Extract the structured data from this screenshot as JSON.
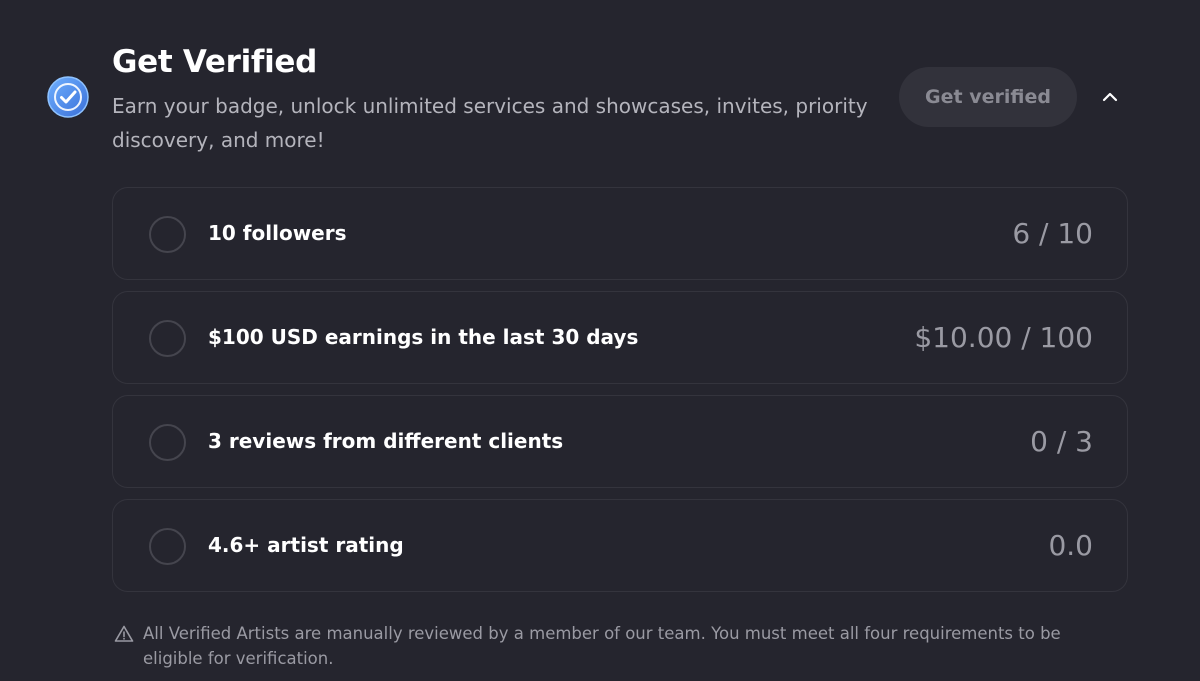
{
  "header": {
    "title": "Get Verified",
    "subtitle": "Earn your badge, unlock unlimited services and showcases, invites, priority discovery, and more!",
    "get_verified_label": "Get verified",
    "badge_icon": "verified-check-icon",
    "toggle_icon": "chevron-up-icon"
  },
  "requirements": [
    {
      "label": "10 followers",
      "progress": "6 / 10"
    },
    {
      "label": "$100 USD earnings in the last 30 days",
      "progress": "$10.00 / 100"
    },
    {
      "label": "3 reviews from different clients",
      "progress": "0 / 3"
    },
    {
      "label": "4.6+ artist rating",
      "progress": "0.0"
    }
  ],
  "footer": {
    "note": "All Verified Artists are manually reviewed by a member of our team. You must meet all four requirements to be eligible for verification.",
    "icon": "warning-triangle-icon"
  },
  "colors": {
    "background": "#25252e",
    "badge_blue": "#4a8fe8",
    "muted_text": "#9a9aa3"
  }
}
